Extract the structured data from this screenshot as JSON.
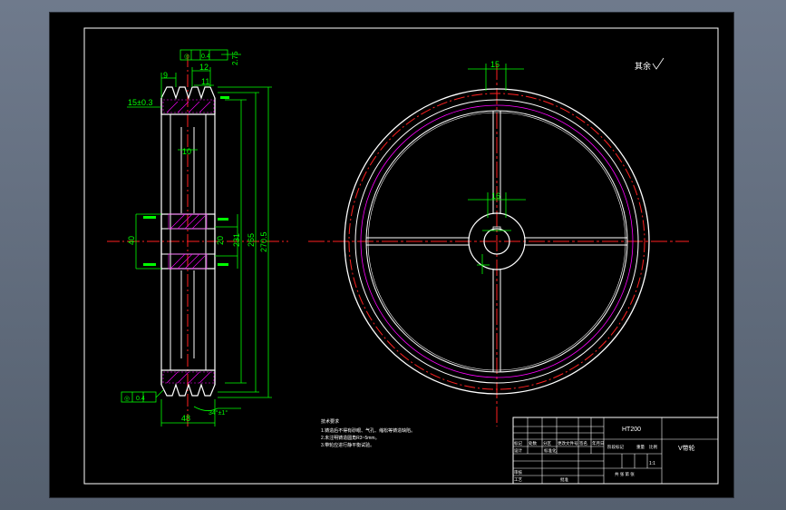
{
  "side_view": {
    "tolerance_frame_top": "0.4",
    "tolerance_frame_bottom": "0.4",
    "dim_groove_pitch_ref": "9",
    "dim_groove_top": "12",
    "dim_groove_width": "11",
    "dim_groove_depth": "2.75",
    "dim_groove_offset": "15±0.3",
    "dim_hub_bore": "10",
    "dim_hub_width": "40",
    "dim_keyway": "20",
    "dim_d1": "231",
    "dim_d2": "265",
    "dim_d3": "270.5",
    "dim_total_width": "48",
    "dim_angle": "34°±1°"
  },
  "front_view": {
    "dim_rim_width": "15",
    "dim_spoke_width": "16"
  },
  "roughness_note": "其余",
  "notes": {
    "title": "技术要求",
    "lines": [
      "1.铸造后不得有砂眼、气孔、缩松等铸造缺陷。",
      "2.未注明铸造圆角R3~5mm。",
      "3.带轮应进行静平衡试验。"
    ]
  },
  "title_block": {
    "material": "HT200",
    "part_name": "V带轮",
    "row_labels": [
      "标记",
      "处数",
      "分区",
      "更改文件号",
      "签名",
      "年月日"
    ],
    "design": "设计",
    "review": "审核",
    "process": "工艺",
    "standard": "标准化",
    "approve": "批准",
    "stage": "阶段标记",
    "weight": "重量",
    "scale": "比例",
    "scale_value": "1:1",
    "sheet_info": "共 张  第 张"
  },
  "colors": {
    "background": "#000000",
    "outline": "#ffffff",
    "centerline": "#ff2020",
    "dimension": "#00ff00",
    "hatch": "#ff00ff",
    "rim_accent": "#ff0000"
  }
}
